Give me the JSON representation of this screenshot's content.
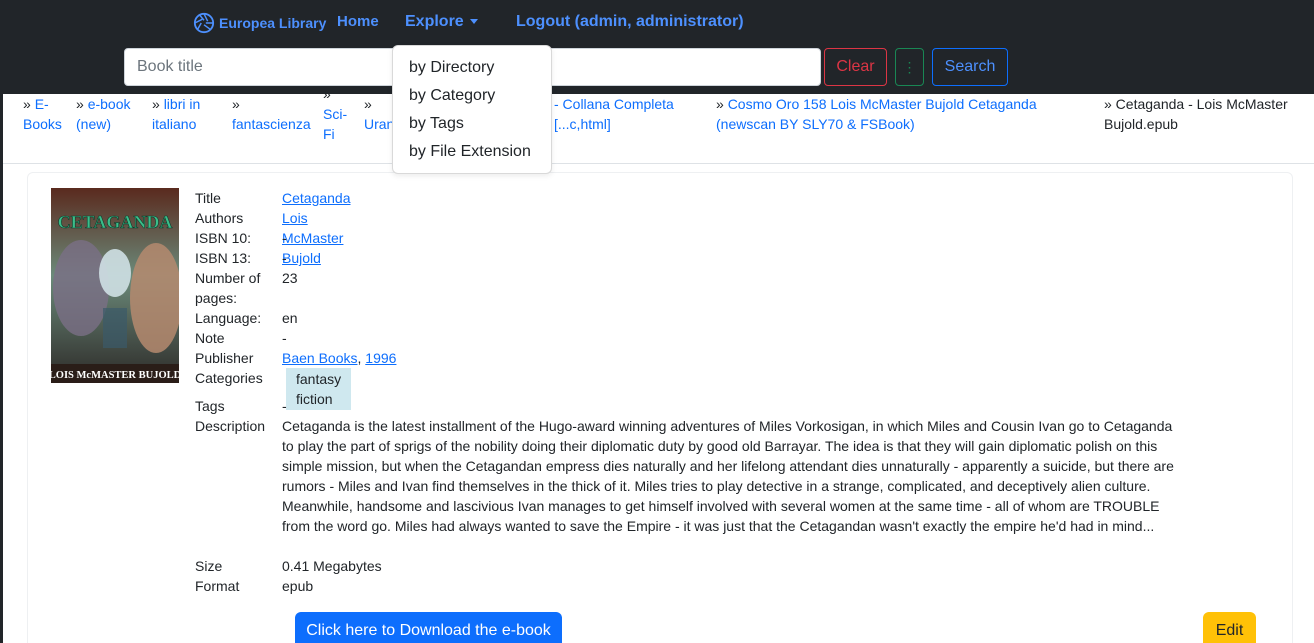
{
  "nav": {
    "brand": "Europea Library",
    "home": "Home",
    "explore": "Explore",
    "logout": "Logout (admin, administrator)"
  },
  "search": {
    "placeholder": "Book title",
    "clear_label": "Clear",
    "more_label": "⋮",
    "search_label": "Search"
  },
  "explore_menu": [
    "by Directory",
    "by Category",
    "by Tags",
    "by File Extension"
  ],
  "breadcrumb": {
    "items": [
      {
        "sep": "»",
        "label": "E-Books"
      },
      {
        "sep": "»",
        "label": "e-book (new)"
      },
      {
        "sep": "»",
        "label": "libri in italiano"
      },
      {
        "sep": "»",
        "label": "fantascienza"
      },
      {
        "sep": "»",
        "label": "Sci-Fi"
      },
      {
        "sep": "»",
        "label": "Urania"
      },
      {
        "sep": "",
        "label": "- Collana Completa [...c,html]"
      },
      {
        "sep": "»",
        "label": "Cosmo Oro 158 Lois McMaster Bujold Cetaganda (newscan BY SLY70 & FSBook)"
      }
    ],
    "current": "» Cetaganda - Lois McMaster Bujold.epub"
  },
  "book": {
    "cover_title": "CETAGANDA",
    "cover_author": "LOIS McMASTER BUJOLD",
    "labels": {
      "title": "Title",
      "authors": "Authors",
      "isbn10": "ISBN 10:",
      "isbn13": "ISBN 13:",
      "pages": "Number of pages:",
      "language": "Language:",
      "note": "Note",
      "publisher": "Publisher",
      "categories": "Categories",
      "tags": "Tags",
      "description": "Description",
      "size": "Size",
      "format": "Format"
    },
    "title": "Cetaganda",
    "authors": "Lois McMaster Bujold",
    "isbn10": "-",
    "isbn13": "-",
    "pages": "23",
    "language": "en",
    "note": "-",
    "publisher": "Baen Books",
    "publisher_sep": ",",
    "year": "1996",
    "category": "fantasy fiction",
    "tags": "-",
    "description": "Cetaganda is the latest installment of the Hugo-award winning adventures of Miles Vorkosigan, in which Miles and Cousin Ivan go to Cetaganda to play the part of sprigs of the nobility doing their diplomatic duty by good old Barrayar. The idea is that they will gain diplomatic polish on this simple mission, but when the Cetagandan empress dies naturally and her lifelong attendant dies unnaturally - apparently a suicide, but there are rumors - Miles and Ivan find themselves in the thick of it. Miles tries to play detective in a strange, complicated, and deceptively alien culture. Meanwhile, handsome and lascivious Ivan manages to get himself involved with several women at the same time - all of whom are TROUBLE from the word go. Miles had always wanted to save the Empire - it was just that the Cetagandan wasn't exactly the empire he'd had in mind...",
    "size": "0.41 Megabytes",
    "format": "epub"
  },
  "actions": {
    "download": "Click here to Download the e-book",
    "edit": "Edit"
  },
  "colors": {
    "navbar_bg": "#212529",
    "link": "#0d6efd",
    "brand": "#4d90fe",
    "danger": "#dc3545",
    "success": "#198754",
    "warning": "#ffc107",
    "badge_bg": "#cfe8ef"
  }
}
